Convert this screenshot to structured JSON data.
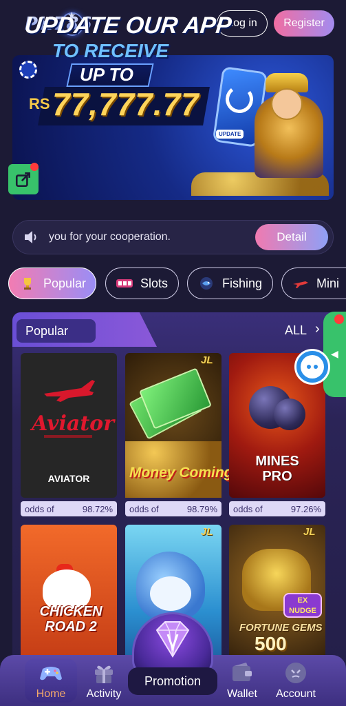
{
  "header": {
    "logo_text": "PK786",
    "login_label": "Log in",
    "register_label": "Register"
  },
  "banner": {
    "line1": "UPDATE OUR APP",
    "line2": "TO RECEIVE",
    "line3": "UP TO",
    "currency": "RS",
    "amount": "77,777.77",
    "phone_tag": "UPDATE",
    "share_icon": "share-icon"
  },
  "notice": {
    "icon": "speaker-icon",
    "text": "you for your cooperation.",
    "detail_label": "Detail"
  },
  "categories": [
    {
      "label": "Popular",
      "icon": "trophy-icon",
      "active": true
    },
    {
      "label": "Slots",
      "icon": "slot-machine-icon",
      "active": false
    },
    {
      "label": "Fishing",
      "icon": "fish-icon",
      "active": false
    },
    {
      "label": "Mini",
      "icon": "plane-icon",
      "active": false
    }
  ],
  "section": {
    "title": "Popular",
    "all_label": "ALL",
    "chevron": "›"
  },
  "games": [
    {
      "name": "Aviator",
      "label": "AVIATOR",
      "odds_label": "odds of",
      "odds_value": "98.72%",
      "provider": ""
    },
    {
      "name": "Money Coming",
      "label": "Money Coming",
      "odds_label": "odds of",
      "odds_value": "98.79%",
      "provider": "JL"
    },
    {
      "name": "Mines Pro",
      "label_line1": "MINES",
      "label_line2": "PRO",
      "odds_label": "odds of",
      "odds_value": "97.26%",
      "provider": ""
    },
    {
      "name": "Chicken Road 2",
      "label_line1": "CHICKEN",
      "label_line2": "ROAD 2",
      "provider": ""
    },
    {
      "name": "Shark",
      "provider": "JL"
    },
    {
      "name": "Fortune Gems 500",
      "label": "FORTUNE GEMS",
      "number": "500",
      "badge_line1": "EX",
      "badge_line2": "NUDGE",
      "provider": "JL"
    }
  ],
  "bottom_nav": {
    "items": [
      {
        "label": "Home",
        "icon": "gamepad-icon",
        "active": true
      },
      {
        "label": "Activity",
        "icon": "gift-icon",
        "active": false
      },
      {
        "label": "Promotion",
        "icon": "diamond-icon",
        "active": false
      },
      {
        "label": "Wallet",
        "icon": "wallet-icon",
        "active": false
      },
      {
        "label": "Account",
        "icon": "account-icon",
        "active": false
      }
    ]
  },
  "colors": {
    "background": "#1c1a35",
    "accent_pink": "#f06ea2",
    "accent_violet": "#a38bef",
    "active_nav": "#f2a86a",
    "float_green": "#38c26b"
  }
}
